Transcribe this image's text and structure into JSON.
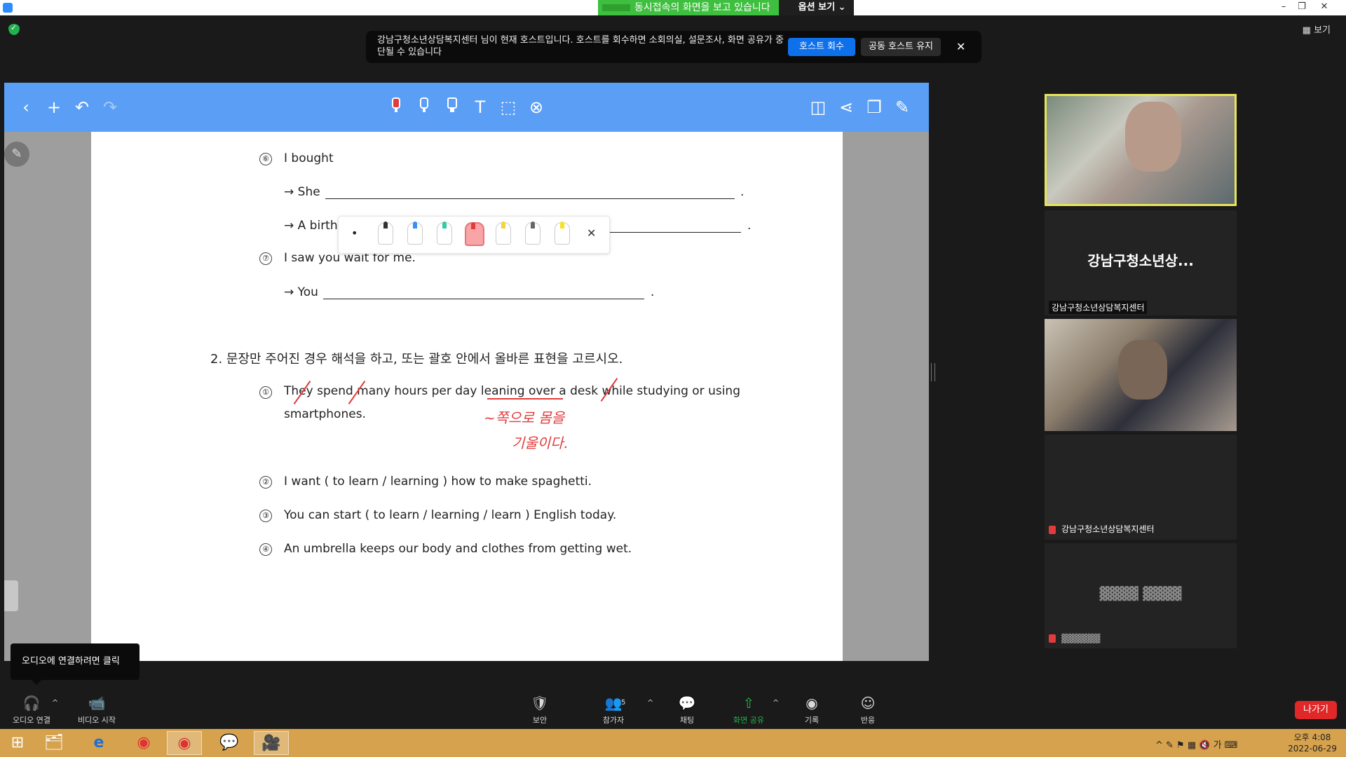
{
  "window": {
    "share_banner_text": "동시접속의 화면을 보고 있습니다",
    "options_label": "옵션 보기 ⌄",
    "min_glyph": "–",
    "restore_glyph": "❐",
    "close_glyph": "✕"
  },
  "top": {
    "view_label": "보기",
    "host_notice": {
      "message": "강남구청소년상담복지센터 님이 현재 호스트입니다. 호스트를 회수하면 소회의실, 설문조사, 화면 공유가 중단될 수 있습니다",
      "reclaim_label": "호스트 회수",
      "keep_label": "공동 호스트 유지",
      "close_glyph": "✕"
    }
  },
  "whiteboard_toolbar": {
    "back": "‹",
    "add": "+",
    "undo": "↶",
    "redo": "↷",
    "text": "T",
    "select": "⬚",
    "erase": "⊗",
    "right_icons": [
      "◫",
      "⋖",
      "❐",
      "✎"
    ]
  },
  "pen_palette": {
    "dot": "•",
    "close": "✕",
    "colors": [
      "#333333",
      "#3a8ff7",
      "#35c9a6",
      "#f08080",
      "#f2d53c",
      "#666666",
      "#f7e21f"
    ]
  },
  "document": {
    "q6_num": "⑥",
    "q6_text": "I bought",
    "q6_she": "→  She",
    "q6_cake": "→  A birthday cake",
    "q7_num": "⑦",
    "q7_text": "I saw you wait for me.",
    "q7_you": "→  You",
    "period": ".",
    "section2": "2.   문장만 주어진 경우 해석을 하고, 또는 괄호 안에서 올바른 표현을 고르시오.",
    "s1_num": "①",
    "s1_line1": "They  spend  many  hours  per  day  leaning  over  a  desk  while  studying  or  using",
    "s1_line2": "smartphones.",
    "hand1": "~쪽으로 몸을",
    "hand2": "기울이다.",
    "s2_num": "②",
    "s2_text": "I want ( to learn / learning ) how to make spaghetti.",
    "s3_num": "③",
    "s3_text": "You can start ( to learn / learning / learn ) English today.",
    "s4_num": "④",
    "s4_text": "An umbrella keeps our body and clothes from getting wet."
  },
  "participants": {
    "tile2_center": "강남구청소년상...",
    "tile2_name": "강남구청소년상담복지센터",
    "tile4_name": "강남구청소년상담복지센터",
    "tile5_center": "▓▓▓▓ ▓▓▓▓",
    "tile5_name": "▓▓▓▓▓▓"
  },
  "controls": {
    "audio_tip": "오디오에 연결하려면 클릭",
    "audio": "오디오 연결",
    "video": "비디오 시작",
    "security": "보안",
    "participants": "참가자",
    "participants_count": "5",
    "chat": "채팅",
    "share": "화면 공유",
    "record": "기록",
    "reactions": "반응",
    "leave": "나가기",
    "caret": "^"
  },
  "taskbar": {
    "start": "⊞",
    "apps": [
      "🗂",
      "e",
      "◉",
      "◉",
      "💬",
      "🎥"
    ],
    "tray": "^  ✎  ⚑  ▦  🔇  가  ⌨",
    "time": "오후 4:08",
    "date": "2022-06-29"
  }
}
